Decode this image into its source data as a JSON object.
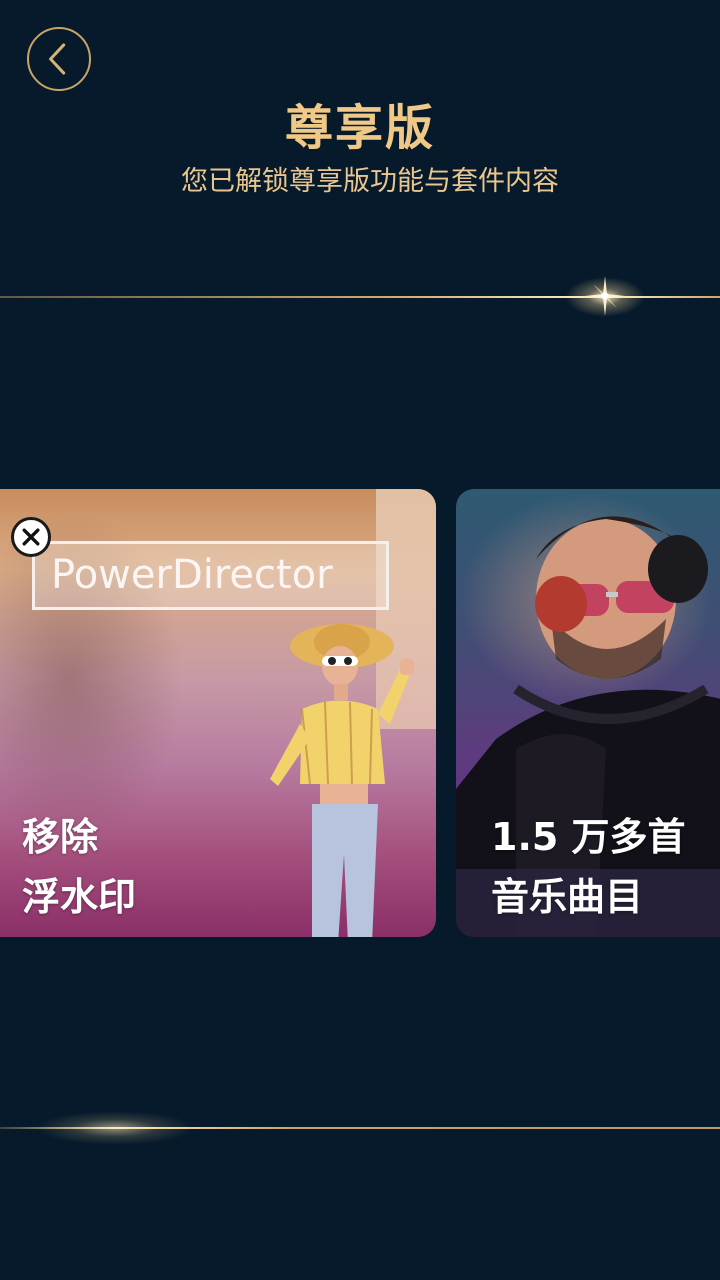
{
  "header": {
    "title": "尊享版",
    "subtitle": "您已解锁尊享版功能与套件内容"
  },
  "cards": [
    {
      "watermark_text": "PowerDirector",
      "label_line1": "移除",
      "label_line2": "浮水印"
    },
    {
      "label_line1": "1.5 万多首",
      "label_line2": "音乐曲目"
    }
  ],
  "icons": {
    "back": "chevron-left-icon",
    "close": "close-icon"
  },
  "colors": {
    "background": "#061a2c",
    "accent_gold": "#c8a466",
    "title_gold": "#f0c987"
  }
}
